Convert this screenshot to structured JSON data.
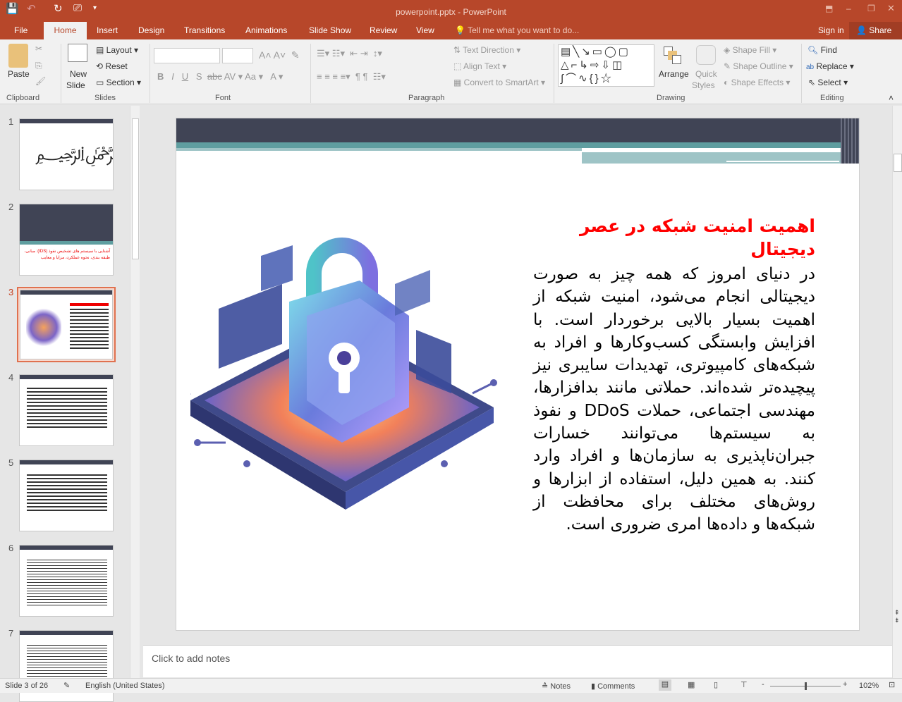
{
  "window": {
    "title": "powerpoint.pptx - PowerPoint"
  },
  "tabs": [
    "File",
    "Home",
    "Insert",
    "Design",
    "Transitions",
    "Animations",
    "Slide Show",
    "Review",
    "View"
  ],
  "tell_me": "Tell me what you want to do...",
  "sign_in": "Sign in",
  "share": "Share",
  "ribbon": {
    "clipboard": {
      "label": "Clipboard",
      "paste": "Paste"
    },
    "slides": {
      "label": "Slides",
      "new_slide": "New",
      "new_slide2": "Slide",
      "layout": "Layout",
      "reset": "Reset",
      "section": "Section"
    },
    "font": {
      "label": "Font"
    },
    "paragraph": {
      "label": "Paragraph",
      "text_direction": "Text Direction",
      "align_text": "Align Text",
      "convert": "Convert to SmartArt"
    },
    "drawing": {
      "label": "Drawing",
      "arrange": "Arrange",
      "quick": "Quick",
      "styles": "Styles",
      "shape_fill": "Shape Fill",
      "shape_outline": "Shape Outline",
      "shape_effects": "Shape Effects"
    },
    "editing": {
      "label": "Editing",
      "find": "Find",
      "replace": "Replace",
      "select": "Select"
    }
  },
  "thumbnails": [
    {
      "n": "1"
    },
    {
      "n": "2",
      "text": "آشنایی با سیستم های تشخیص نفوذ (IDS): مبانی، طبقه بندی، نحوه عملکرد، مزایا و معایب"
    },
    {
      "n": "3",
      "selected": true
    },
    {
      "n": "4"
    },
    {
      "n": "5"
    },
    {
      "n": "6"
    },
    {
      "n": "7"
    }
  ],
  "slide": {
    "title": "اهمیت امنیت شبکه در عصر دیجیتال",
    "body": "در دنیای امروز که همه چیز به صورت دیجیتالی انجام می‌شود، امنیت شبکه از اهمیت بسیار بالایی برخوردار است. با افزایش وابستگی کسب‌وکارها و افراد به شبکه‌های کامپیوتری، تهدیدات سایبری نیز پیچیده‌تر شده‌اند. حملاتی مانند بدافزارها، مهندسی اجتماعی، حملات DDoS و نفوذ به سیستم‌ها می‌توانند خسارات جبران‌ناپذیری به سازمان‌ها و افراد وارد کنند. به همین دلیل، استفاده از ابزارها و روش‌های مختلف برای محافظت از شبکه‌ها و داده‌ها امری ضروری است.",
    "image": "padlock-network-security-illustration"
  },
  "notes_placeholder": "Click to add notes",
  "status": {
    "slide": "Slide 3 of 26",
    "language": "English (United States)",
    "notes": "Notes",
    "comments": "Comments",
    "zoom": "102%",
    "zoom_level": 0.51
  },
  "colors": {
    "brand": "#b7472a",
    "title_red": "#ff0000",
    "header_dark": "#404455",
    "teal": "#5f9ea0"
  }
}
